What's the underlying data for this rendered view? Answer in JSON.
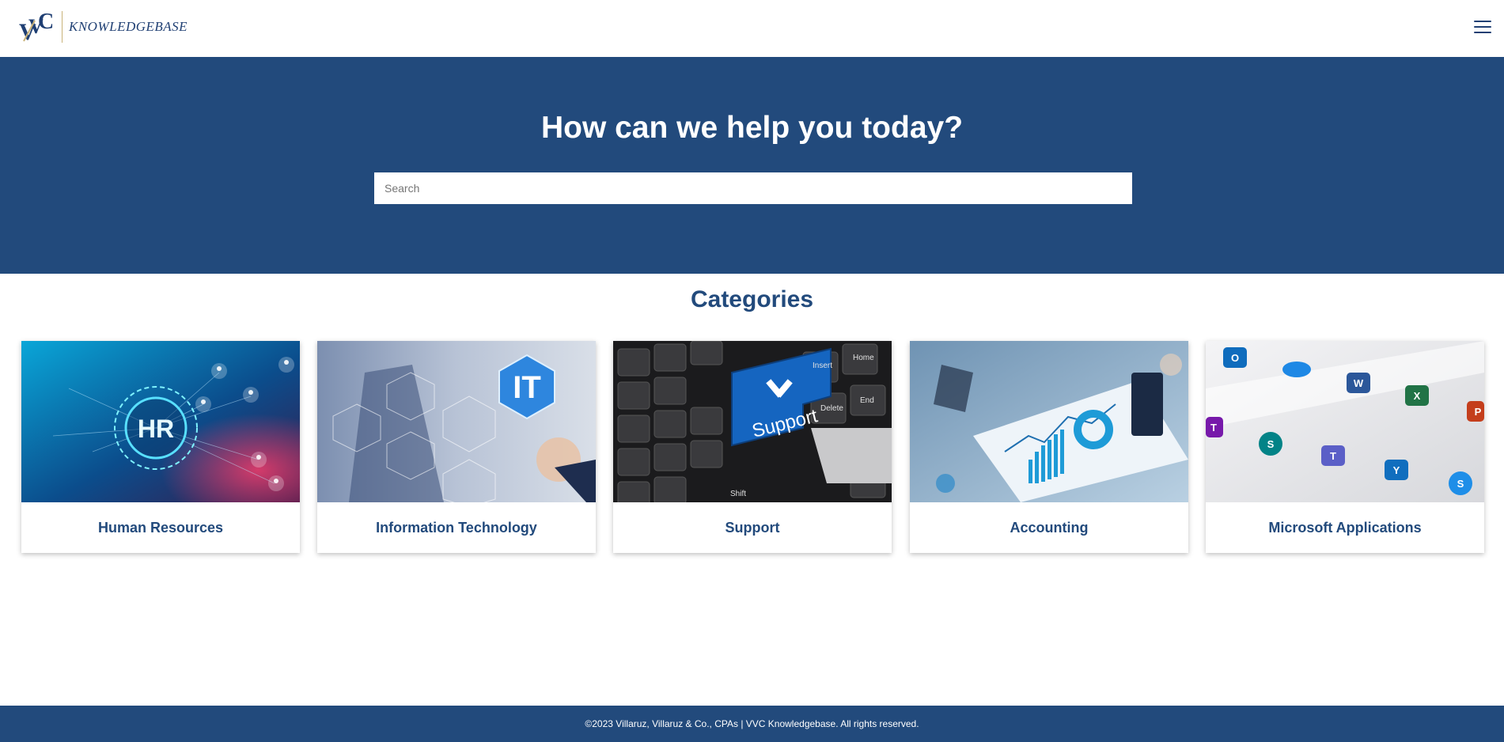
{
  "header": {
    "logo_text": "KNOWLEDGEBASE",
    "menu_icon": "hamburger-menu-icon"
  },
  "hero": {
    "title": "How can we help you today?",
    "search_placeholder": "Search",
    "search_value": ""
  },
  "categories": {
    "title": "Categories",
    "items": [
      {
        "label": "Human Resources",
        "image": "hr-network-image"
      },
      {
        "label": "Information Technology",
        "image": "it-hexagon-image"
      },
      {
        "label": "Support",
        "image": "support-keyboard-image"
      },
      {
        "label": "Accounting",
        "image": "accounting-charts-image"
      },
      {
        "label": "Microsoft Applications",
        "image": "microsoft-apps-image"
      }
    ]
  },
  "footer": {
    "text": "©2023 Villaruz, Villaruz & Co., CPAs | VVC Knowledgebase. All rights reserved."
  },
  "colors": {
    "brand_blue": "#224a7c",
    "logo_gold": "#c9b37a",
    "background": "#ffffff"
  }
}
